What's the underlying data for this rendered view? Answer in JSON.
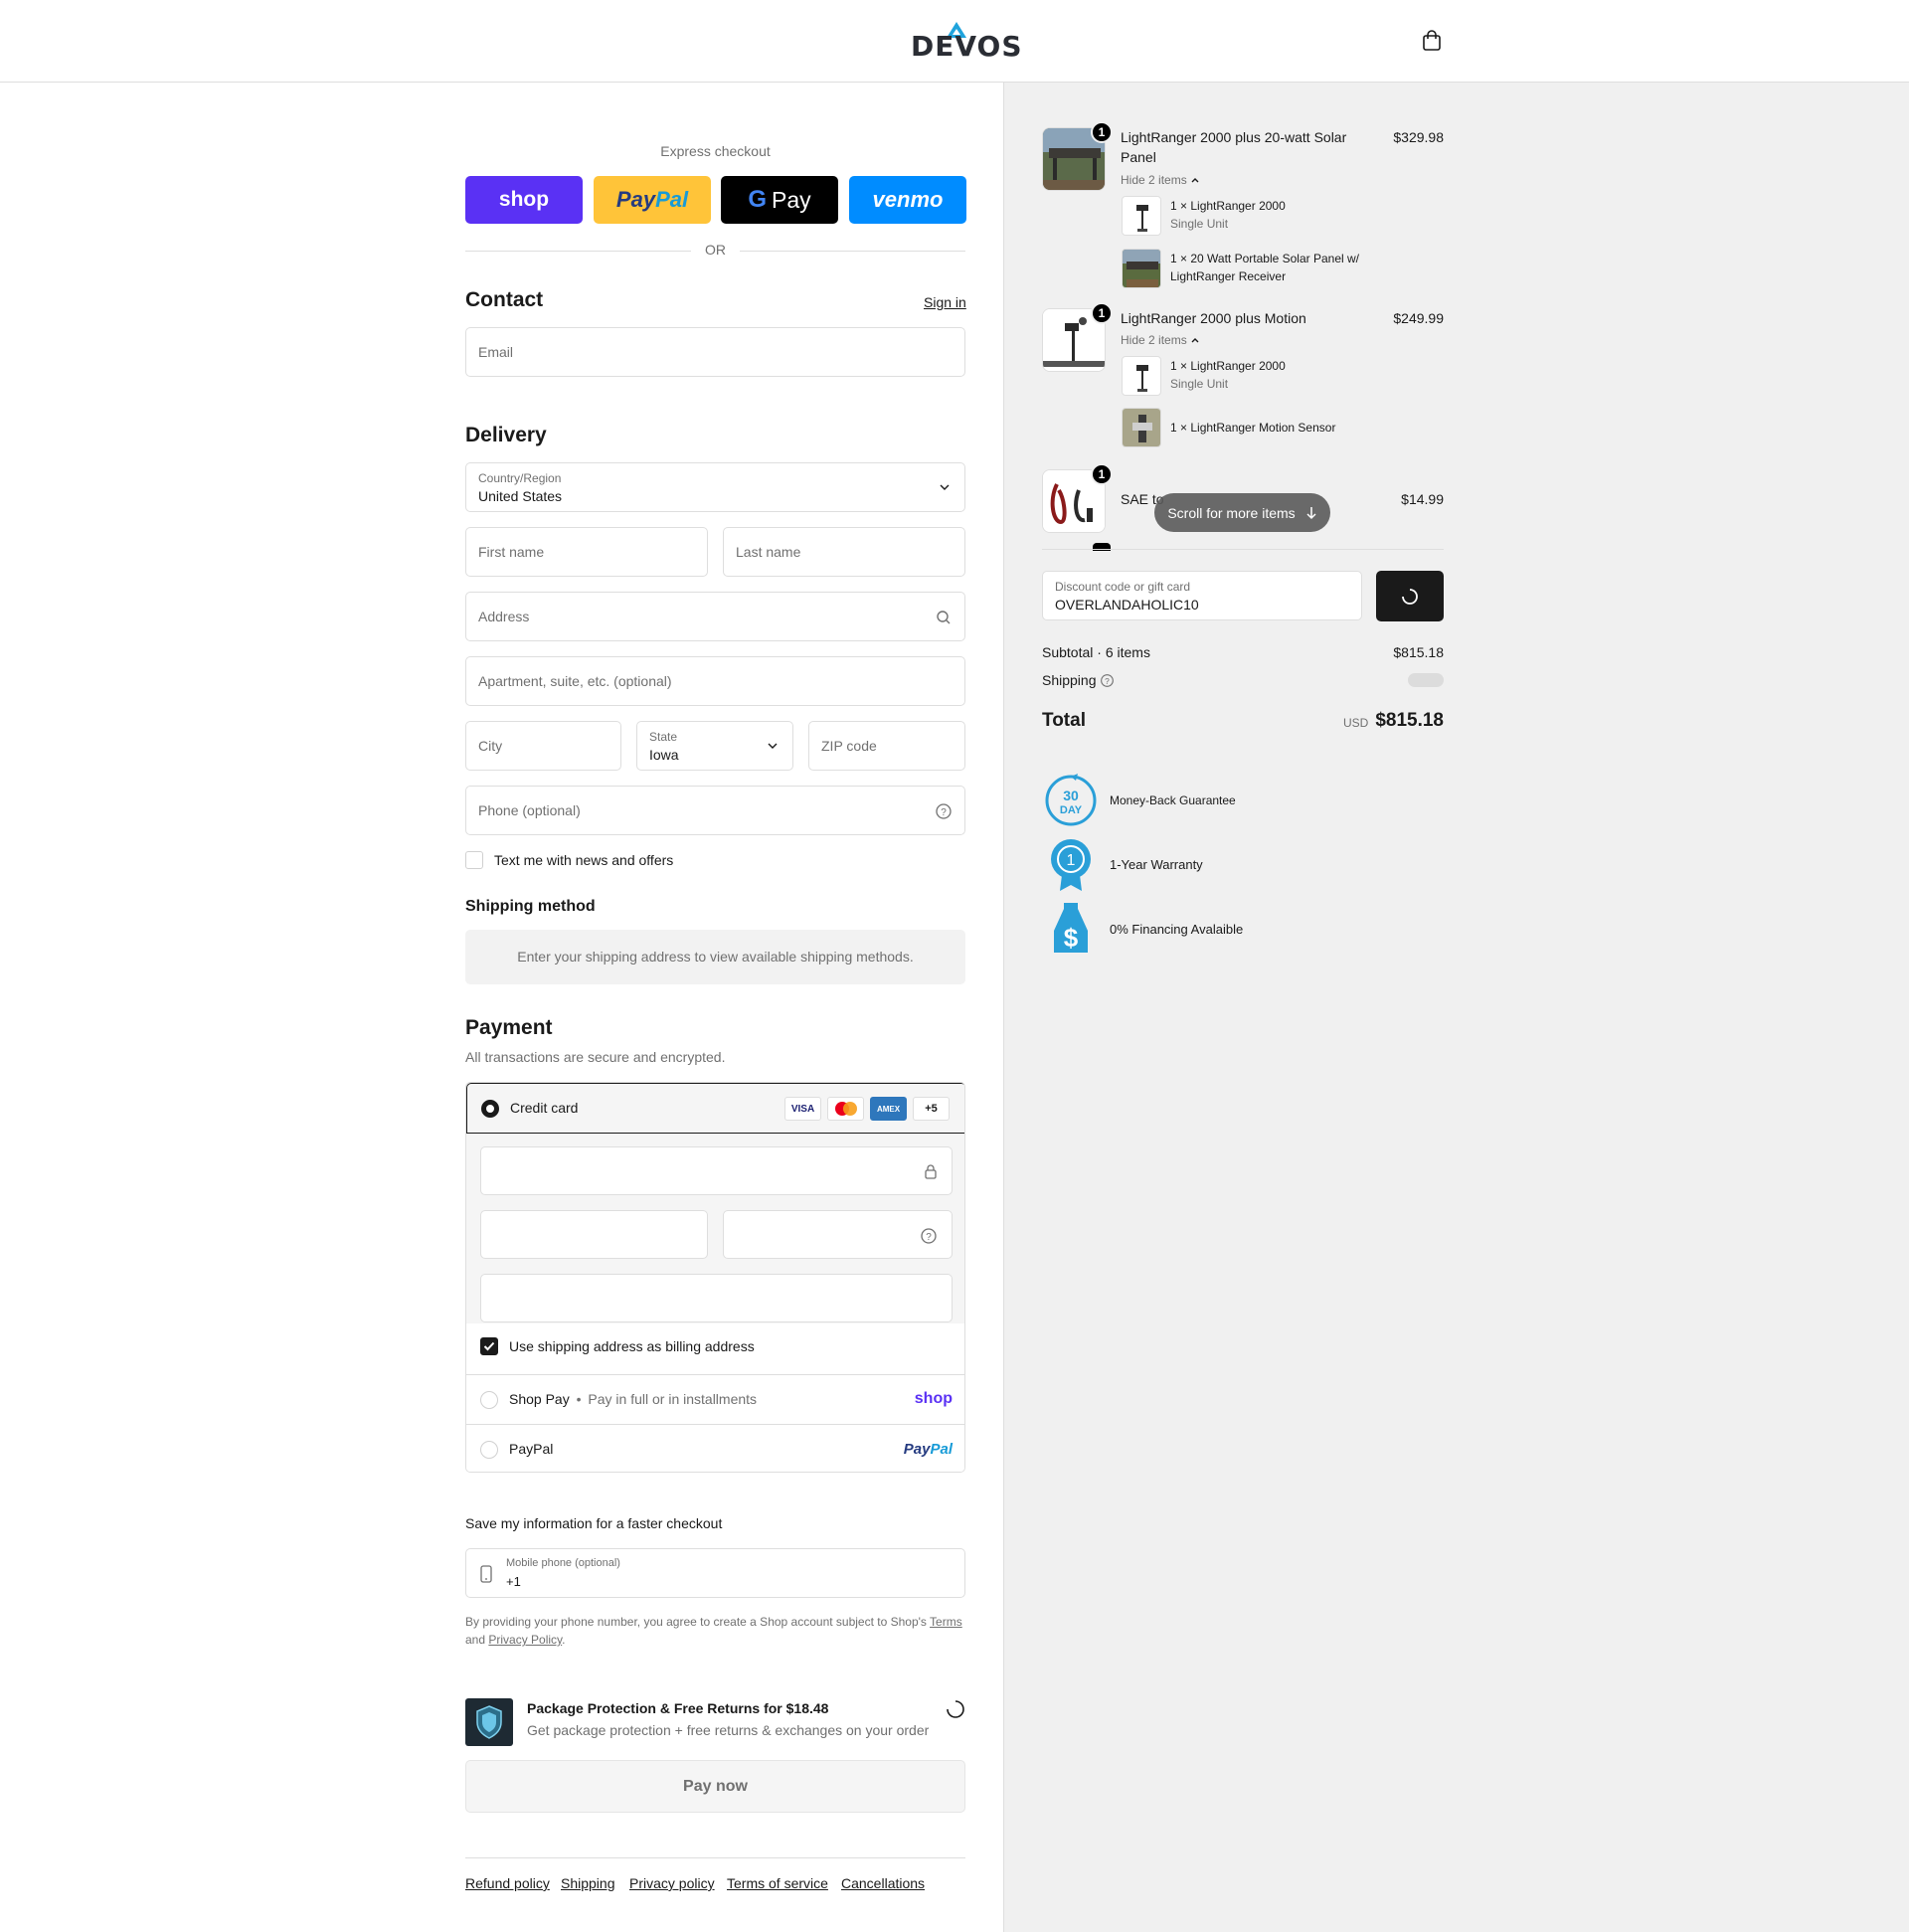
{
  "brand": {
    "name": "DEVOS"
  },
  "express": {
    "title": "Express checkout",
    "shop": "shop",
    "paypal_a": "Pay",
    "paypal_b": "Pal",
    "gpay": "Pay",
    "venmo": "venmo",
    "or": "OR"
  },
  "contact": {
    "title": "Contact",
    "sign_in": "Sign in",
    "email_placeholder": "Email"
  },
  "delivery": {
    "title": "Delivery",
    "country_label": "Country/Region",
    "country_value": "United States",
    "first_name": "First name",
    "last_name": "Last name",
    "address": "Address",
    "apartment": "Apartment, suite, etc. (optional)",
    "city": "City",
    "state_label": "State",
    "state_value": "Iowa",
    "zip": "ZIP code",
    "phone": "Phone (optional)",
    "text_me": "Text me with news and offers"
  },
  "shipping_method": {
    "title": "Shipping method",
    "message": "Enter your shipping address to view available shipping methods."
  },
  "payment": {
    "title": "Payment",
    "subtitle": "All transactions are secure and encrypted.",
    "credit_card": "Credit card",
    "cards": [
      "VISA",
      "MC",
      "AMEX",
      "+5"
    ],
    "billing_same": "Use shipping address as billing address",
    "shop_pay": "Shop Pay",
    "shop_pay_sub": "Pay in full or in installments",
    "shop_pay_logo": "shop",
    "paypal": "PayPal",
    "paypal_logo_a": "Pay",
    "paypal_logo_b": "Pal"
  },
  "save_info": {
    "title": "Save my information for a faster checkout",
    "mobile_label": "Mobile phone (optional)",
    "mobile_value": "+1",
    "disclaimer_a": "By providing your phone number, you agree to create a Shop account subject to Shop's",
    "terms": "Terms",
    "and": "and",
    "privacy": "Privacy Policy",
    "period": "."
  },
  "package_protection": {
    "title": "Package Protection & Free Returns for $18.48",
    "subtitle": "Get package protection + free returns & exchanges on your order"
  },
  "pay_now": "Pay now",
  "footer": [
    "Refund policy",
    "Shipping",
    "Privacy policy",
    "Terms of service",
    "Cancellations"
  ],
  "summary": {
    "items": [
      {
        "qty": "1",
        "title_line1": "LightRanger 2000 plus 20-watt Solar",
        "title_line2": "Panel",
        "price": "$329.98",
        "hide": "Hide 2 items",
        "sub": [
          {
            "title": "1 × LightRanger 2000",
            "variant": "Single Unit"
          },
          {
            "title": "1 × 20 Watt Portable Solar Panel w/",
            "title2": "LightRanger Receiver"
          }
        ]
      },
      {
        "qty": "1",
        "title_line1": "LightRanger 2000 plus Motion",
        "price": "$249.99",
        "hide": "Hide 2 items",
        "sub": [
          {
            "title": "1 × LightRanger 2000",
            "variant": "Single Unit"
          },
          {
            "title": "1 × LightRanger Motion Sensor"
          }
        ]
      },
      {
        "qty": "1",
        "title_line1": "SAE to",
        "price": "$14.99"
      }
    ],
    "scroll_pill": "Scroll for more items",
    "discount_label": "Discount code or gift card",
    "discount_value": "OVERLANDAHOLIC10",
    "subtotal_label": "Subtotal · 6 items",
    "subtotal_value": "$815.18",
    "shipping_label": "Shipping",
    "total_label": "Total",
    "currency": "USD",
    "total_value": "$815.18"
  },
  "badges": [
    {
      "icon_text": "30",
      "icon_text2": "DAY",
      "text": "Money-Back Guarantee"
    },
    {
      "icon_text": "1",
      "text": "1-Year Warranty"
    },
    {
      "icon_text": "$",
      "text": "0% Financing Avalaible"
    }
  ],
  "colors": {
    "shop": "#5a31f4",
    "paypal": "#ffc439",
    "venmo": "#008cff",
    "badge_blue": "#2a9fd8"
  }
}
